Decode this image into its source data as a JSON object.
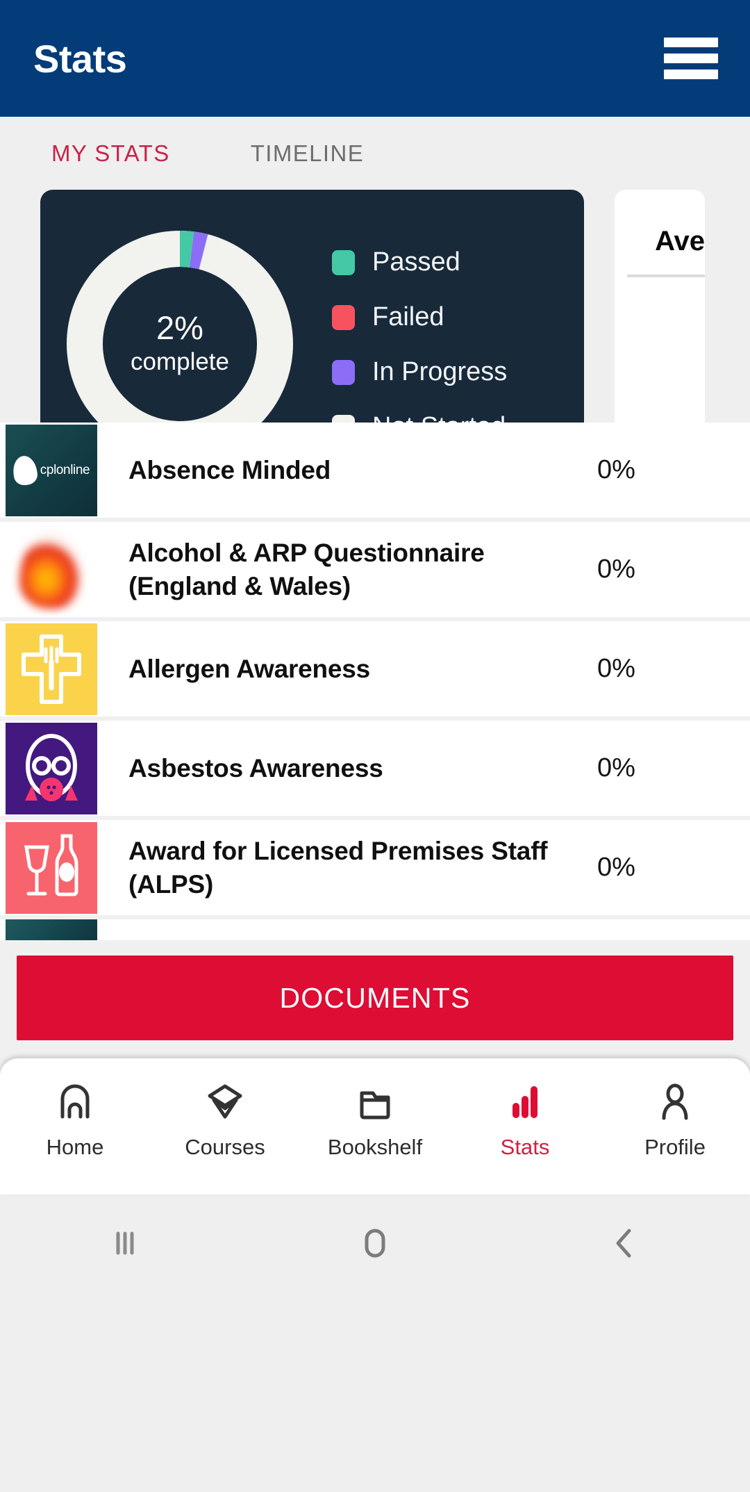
{
  "appbar": {
    "title": "Stats",
    "menu_icon": "hamburger-menu-icon",
    "background": "#033c78"
  },
  "tabs": [
    {
      "label": "MY STATS",
      "active": true
    },
    {
      "label": "TIMELINE",
      "active": false
    }
  ],
  "stats_card": {
    "percent_text": "2%",
    "complete_label": "complete",
    "background": "#18293a",
    "legend": [
      {
        "label": "Passed",
        "color": "#45c9a5"
      },
      {
        "label": "Failed",
        "color": "#f9525f"
      },
      {
        "label": "In Progress",
        "color": "#8b6ef5"
      },
      {
        "label": "Not Started",
        "color": "#f2f2ee"
      }
    ]
  },
  "average_card": {
    "title": "Ave"
  },
  "chart_data": {
    "type": "pie",
    "title": "2% complete",
    "labels": [
      "Passed",
      "Failed",
      "In Progress",
      "Not Started"
    ],
    "values": [
      2,
      0,
      2,
      96
    ],
    "colors": [
      "#45c9a5",
      "#f9525f",
      "#8b6ef5",
      "#f2f2ee"
    ],
    "unit": "%",
    "center_label": "2% complete",
    "legend_position": "right",
    "grid": false
  },
  "courses": [
    {
      "title": "Absence Minded",
      "percent": "0%",
      "thumb": "cplonline-logo-thumbnail",
      "thumb_style": "tn-cpl",
      "wordmark": "cplonline"
    },
    {
      "title": "Alcohol & ARP Questionnaire (England & Wales)",
      "percent": "0%",
      "thumb": "flame-thumbnail",
      "thumb_style": "tn-alcohol"
    },
    {
      "title": "Allergen Awareness",
      "percent": "0%",
      "thumb": "medical-cross-fork-thumbnail",
      "thumb_style": "tn-allergen"
    },
    {
      "title": "Asbestos Awareness",
      "percent": "0%",
      "thumb": "gas-mask-thumbnail",
      "thumb_style": "tn-asbestos"
    },
    {
      "title": "Award for Licensed Premises Staff (ALPS)",
      "percent": "0%",
      "thumb": "wine-glass-bottle-thumbnail",
      "thumb_style": "tn-alps"
    },
    {
      "title": "",
      "percent": "",
      "thumb": "teal-thumbnail",
      "thumb_style": "tn-teal",
      "clipped": true
    }
  ],
  "documents_button": {
    "label": "DOCUMENTS",
    "color": "#dd0d34"
  },
  "bottom_nav": {
    "active_color": "#d11f43",
    "items": [
      {
        "label": "Home",
        "icon": "home-icon",
        "active": false
      },
      {
        "label": "Courses",
        "icon": "graduation-cap-icon",
        "active": false
      },
      {
        "label": "Bookshelf",
        "icon": "folder-icon",
        "active": false
      },
      {
        "label": "Stats",
        "icon": "bar-chart-icon",
        "active": true
      },
      {
        "label": "Profile",
        "icon": "person-icon",
        "active": false
      }
    ]
  },
  "system_nav": [
    {
      "icon": "recents-icon"
    },
    {
      "icon": "home-circle-icon"
    },
    {
      "icon": "back-chevron-icon"
    }
  ]
}
